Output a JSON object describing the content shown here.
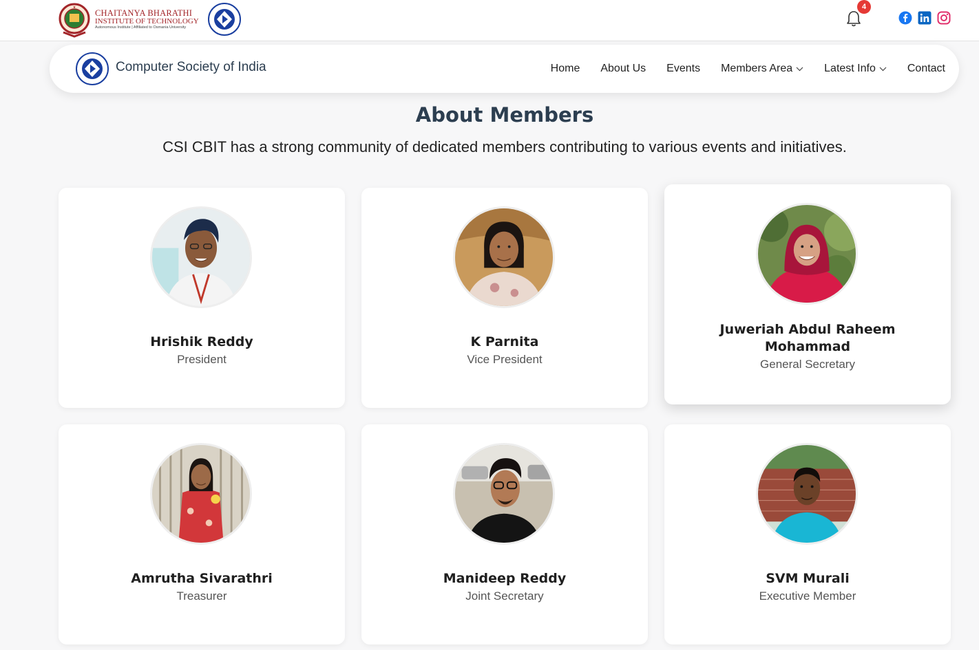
{
  "header": {
    "college_name_line1": "CHAITANYA BHARATHI",
    "college_name_line2": "INSTITUTE OF TECHNOLOGY",
    "college_tagline": "Autonomous Institute | Affiliated to Osmania University",
    "notification_count": "4",
    "icons": [
      "cbit-logo",
      "csi-logo",
      "bell-icon",
      "facebook-icon",
      "linkedin-icon",
      "instagram-icon"
    ],
    "colors": {
      "brand_red": "#a3262a",
      "facebook": "#1877f2",
      "linkedin": "#0a66c2",
      "instagram": "#e1306c",
      "badge": "#e53935"
    }
  },
  "nav": {
    "title": "Computer Society of India",
    "links": {
      "home": "Home",
      "about": "About Us",
      "events": "Events",
      "members": "Members Area",
      "latest": "Latest Info",
      "contact": "Contact"
    }
  },
  "page": {
    "title": "About Members",
    "subtitle": "CSI CBIT has a strong community of dedicated members contributing to various events and initiatives."
  },
  "members": [
    {
      "name": "Hrishik Reddy",
      "role": "President"
    },
    {
      "name": "K Parnita",
      "role": "Vice President"
    },
    {
      "name": "Juweriah Abdul Raheem Mohammad",
      "role": "General Secretary"
    },
    {
      "name": "Amrutha Sivarathri",
      "role": "Treasurer"
    },
    {
      "name": "Manideep Reddy",
      "role": "Joint Secretary"
    },
    {
      "name": "SVM Murali",
      "role": "Executive Member"
    }
  ]
}
